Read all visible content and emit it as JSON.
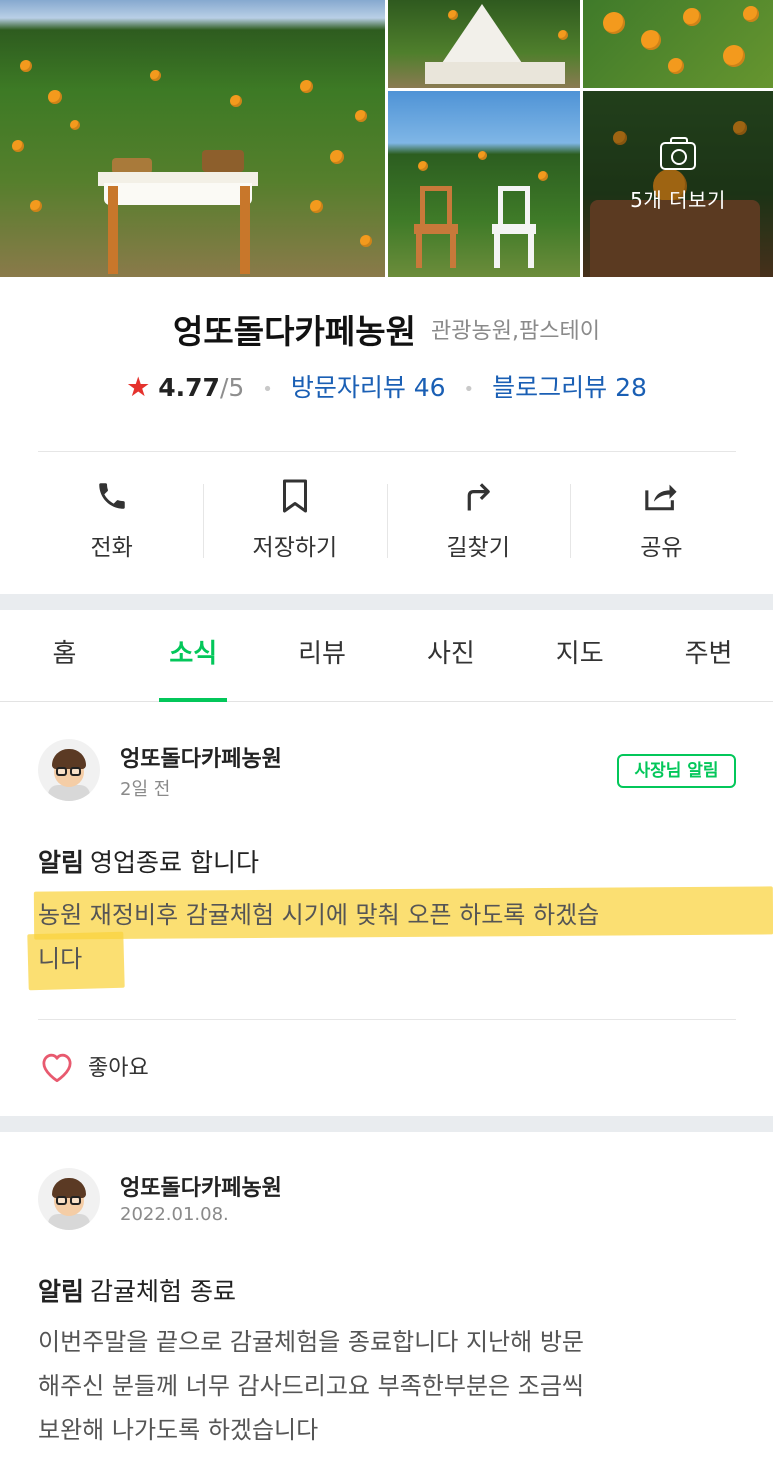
{
  "photos": {
    "more_label": "5개 더보기",
    "more_icon": "camera-icon"
  },
  "place": {
    "name": "엉또돌다카페농원",
    "category": "관광농원,팜스테이",
    "rating": "4.77",
    "rating_max": "/5",
    "visitor_reviews": "방문자리뷰 46",
    "blog_reviews": "블로그리뷰 28"
  },
  "actions": [
    {
      "label": "전화",
      "icon": "phone-icon"
    },
    {
      "label": "저장하기",
      "icon": "bookmark-icon"
    },
    {
      "label": "길찾기",
      "icon": "directions-icon"
    },
    {
      "label": "공유",
      "icon": "share-icon"
    }
  ],
  "tabs": [
    {
      "label": "홈"
    },
    {
      "label": "소식",
      "active": true
    },
    {
      "label": "리뷰"
    },
    {
      "label": "사진"
    },
    {
      "label": "지도"
    },
    {
      "label": "주변"
    }
  ],
  "posts": [
    {
      "author": "엉또돌다카페농원",
      "time": "2일 전",
      "badge": "사장님 알림",
      "title_tag": "알림",
      "title": "영업종료 합니다",
      "body_line1": "농원 재정비후 감귤체험 시기에 맞춰 오픈 하도록 하겠습",
      "body_line2": "니다",
      "like_label": "좋아요"
    },
    {
      "author": "엉또돌다카페농원",
      "time": "2022.01.08.",
      "title_tag": "알림",
      "title": "감귤체험 종료",
      "body_line1": "이번주말을 끝으로 감귤체험을 종료합니다 지난해 방문",
      "body_line2": "해주신 분들께 너무 감사드리고요 부족한부분은 조금씩",
      "body_line3": "보완해 나가도록 하겠습니다"
    }
  ],
  "colors": {
    "accent": "#03c75a",
    "link": "#1a5fb4",
    "star": "#e5322d",
    "highlight": "#fad23c"
  }
}
